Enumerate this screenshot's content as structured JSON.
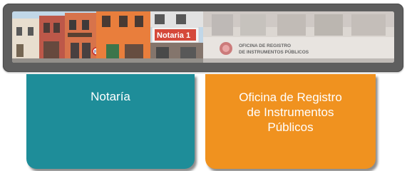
{
  "banner": {
    "left_photo": {
      "sign_text": "Notaría 1"
    },
    "right_photo": {
      "sign_text": "OFICINA DE REGISTRO\nDE INSTRUMENTOS PÚBLICOS"
    }
  },
  "cards": [
    {
      "label": "Notaría",
      "color": "#1e8d99"
    },
    {
      "label": "Oficina de Registro de Instrumentos Públicos",
      "color": "#f0921f"
    }
  ],
  "colors": {
    "frame": "#5e5e5e",
    "teal": "#1e8d99",
    "orange": "#f0921f"
  }
}
